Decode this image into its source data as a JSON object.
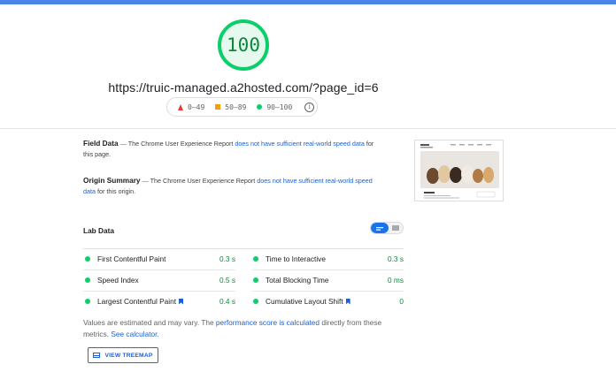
{
  "score": {
    "value": "100",
    "fraction": 1.0,
    "color": "#0cce6b"
  },
  "url": "https://truic-managed.a2hosted.com/?page_id=6",
  "legend": {
    "fail": "0–49",
    "average": "50–89",
    "pass": "90–100",
    "info_icon": "info-icon"
  },
  "field_data": {
    "title": "Field Data",
    "dash": "—",
    "text_before": "The Chrome User Experience Report",
    "link": "does not have sufficient real-world speed data",
    "text_after": "for this page."
  },
  "origin_summary": {
    "title": "Origin Summary",
    "dash": "—",
    "text_before": "The Chrome User Experience Report",
    "link": "does not have sufficient real-world speed data",
    "text_after": "for this origin."
  },
  "lab_data": {
    "title": "Lab Data",
    "toggle_icons": [
      "list-view-icon",
      "text-view-icon"
    ],
    "metrics": [
      {
        "name": "First Contentful Paint",
        "value": "0.3 s",
        "bookmark": false
      },
      {
        "name": "Time to Interactive",
        "value": "0.3 s",
        "bookmark": false
      },
      {
        "name": "Speed Index",
        "value": "0.5 s",
        "bookmark": false
      },
      {
        "name": "Total Blocking Time",
        "value": "0 ms",
        "bookmark": false
      },
      {
        "name": "Largest Contentful Paint",
        "value": "0.4 s",
        "bookmark": true
      },
      {
        "name": "Cumulative Layout Shift",
        "value": "0",
        "bookmark": true
      }
    ]
  },
  "note": {
    "text1": "Values are estimated and may vary. The",
    "link1": "performance score is calculated",
    "text2": "directly from these metrics.",
    "link2": "See calculator."
  },
  "treemap_button": {
    "label": "VIEW TREEMAP",
    "icon": "treemap-icon"
  },
  "colors": {
    "pass": "#0cce6b",
    "average": "#ffa400",
    "fail": "#ff4e42",
    "link": "#1a5fd6",
    "accent": "#1a73e8"
  }
}
